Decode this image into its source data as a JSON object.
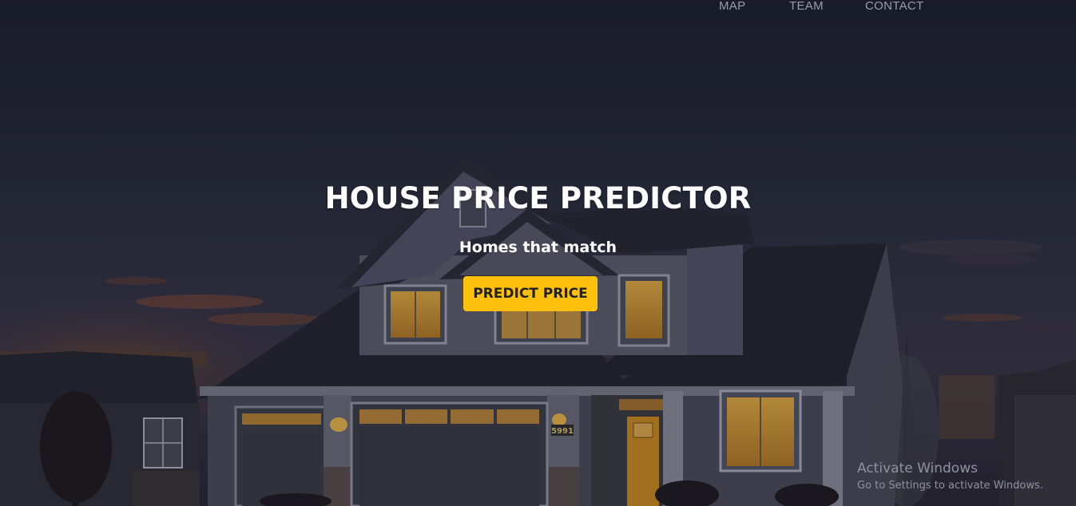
{
  "nav": {
    "items": [
      {
        "label": "MAP"
      },
      {
        "label": "TEAM"
      },
      {
        "label": "CONTACT"
      }
    ]
  },
  "hero": {
    "title": "HOUSE PRICE PREDICTOR",
    "subtitle": "Homes that match",
    "cta_label": "PREDICT PRICE",
    "house_number": "5991"
  },
  "watermark": {
    "title": "Activate Windows",
    "subtitle": "Go to Settings to activate Windows."
  },
  "colors": {
    "accent": "#fec00c",
    "nav_text": "#9a9ca8",
    "window_glow": "#d9a441"
  }
}
